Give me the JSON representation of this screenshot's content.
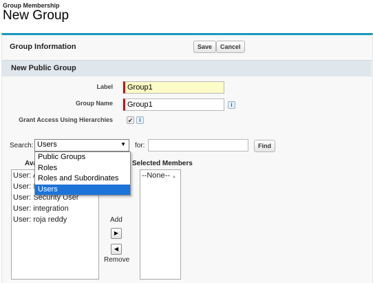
{
  "header": {
    "breadcrumb": "Group Membership",
    "title": "New Group"
  },
  "section": {
    "title": "Group Information",
    "save_label": "Save",
    "cancel_label": "Cancel",
    "subsection_title": "New Public Group"
  },
  "form": {
    "label_label": "Label",
    "label_value": "Group1",
    "group_name_label": "Group Name",
    "group_name_value": "Group1",
    "grant_access_label": "Grant Access Using Hierarchies",
    "grant_access_checked": true,
    "info_glyph": "i",
    "check_glyph": "✔"
  },
  "search": {
    "search_label": "Search:",
    "selected_option": "Users",
    "options": [
      "Public Groups",
      "Roles",
      "Roles and Subordinates",
      "Users"
    ],
    "for_label": "for:",
    "for_value": "",
    "find_label": "Find"
  },
  "members": {
    "available_label_visible": "Ava",
    "selected_label": "Selected Members",
    "available_items": [
      "User: A",
      "User: I",
      "User: Security User",
      "User: integration",
      "User: roja reddy"
    ],
    "selected_items": [
      "--None--"
    ],
    "add_label": "Add",
    "remove_label": "Remove"
  },
  "colors": {
    "accent": "#1797c0",
    "required": "#cc0000",
    "highlight": "#fdfbc7",
    "selected_option": "#1e73d8"
  }
}
